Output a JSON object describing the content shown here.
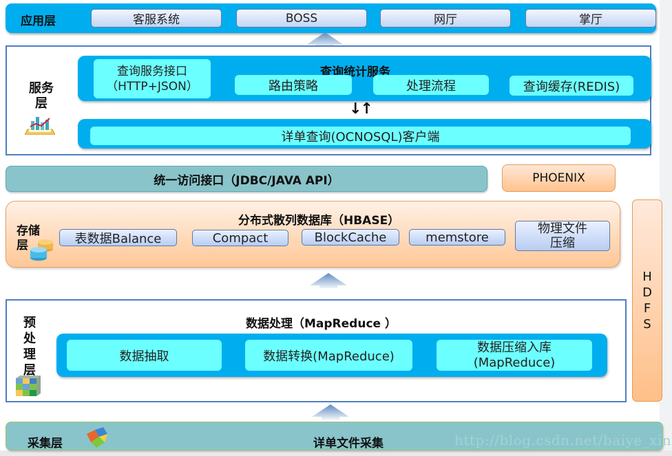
{
  "application_layer": {
    "title": "应用层",
    "items": [
      "客服系统",
      "BOSS",
      "网厅",
      "掌厅"
    ]
  },
  "service_layer": {
    "title_line1": "服务",
    "title_line2": "层",
    "icon": "chart-report-icon",
    "query_interface_line1": "查询服务接口",
    "query_interface_line2": "（HTTP+JSON）",
    "stats_service_title": "查询统计服务",
    "stats_items": [
      "路由策略",
      "处理流程",
      "查询缓存(REDIS)"
    ],
    "arrows": "↓↑",
    "client": "详单查询(OCNOSQL)客户端"
  },
  "unified_interface": {
    "label": "统一访问接口（JDBC/JAVA API）"
  },
  "phoenix": {
    "label": "PHOENIX"
  },
  "storage_layer": {
    "title_line1": "存储",
    "title_line2": "层",
    "icon": "database-icon",
    "hbase_title": "分布式散列数据库（HBASE）",
    "items": [
      "表数据Balance",
      "Compact",
      "BlockCache",
      "memstore"
    ],
    "compression_line1": "物理文件",
    "compression_line2": "压缩"
  },
  "hdfs": {
    "letters": [
      "H",
      "D",
      "F",
      "S"
    ]
  },
  "preprocessing_layer": {
    "title_chars": [
      "预",
      "处",
      "理",
      "层"
    ],
    "icon": "cube-icon",
    "title": "数据处理（MapReduce ）",
    "items": [
      "数据抽取",
      "数据转换(MapReduce)"
    ],
    "compress_line1": "数据压缩入库",
    "compress_line2": "(MapReduce)"
  },
  "collection_layer": {
    "title": "采集层",
    "icon": "puzzle-icon",
    "label": "详单文件采集"
  },
  "watermark": "http://blog.csdn.net/baiye_xing"
}
